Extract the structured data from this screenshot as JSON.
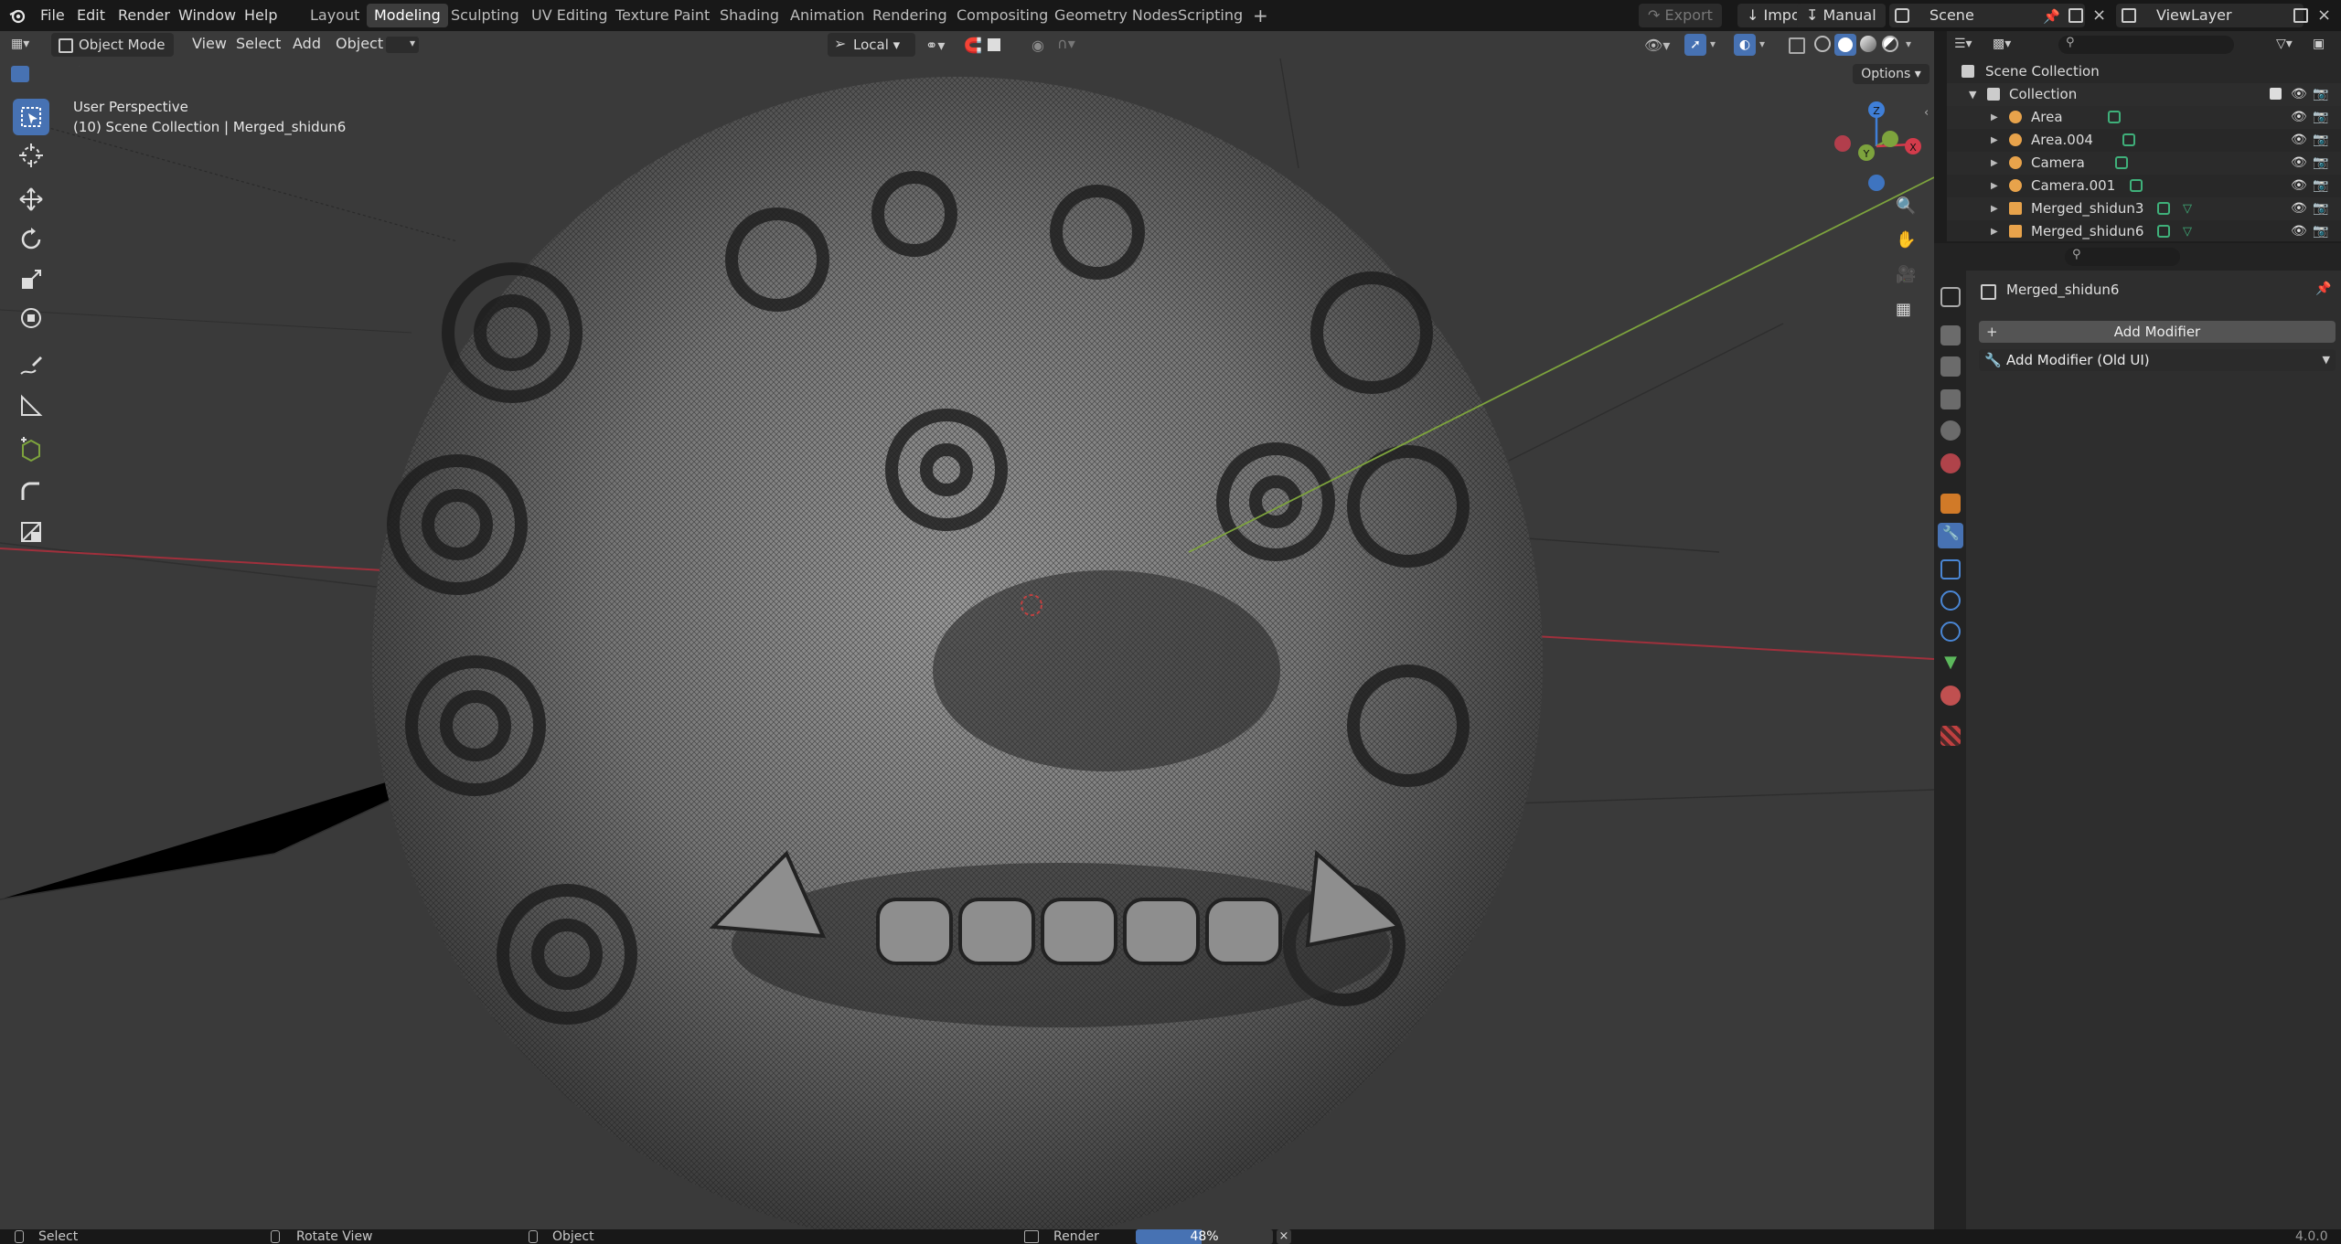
{
  "menubar": {
    "menus": [
      "File",
      "Edit",
      "Render",
      "Window",
      "Help"
    ],
    "workspaces": [
      "Layout",
      "Modeling",
      "Sculpting",
      "UV Editing",
      "Texture Paint",
      "Shading",
      "Animation",
      "Rendering",
      "Compositing",
      "Geometry Nodes",
      "Scripting"
    ],
    "active_workspace": "Modeling",
    "export_label": "Export",
    "import_label": "Import",
    "manual_label": "Manual",
    "scene_name": "Scene",
    "view_layer_name": "ViewLayer"
  },
  "viewport_header": {
    "mode": "Object Mode",
    "menus": [
      "View",
      "Select",
      "Add",
      "Object"
    ],
    "orientation": "Local",
    "options_label": "Options"
  },
  "viewport": {
    "perspective_label": "User Perspective",
    "object_info": "(10) Scene Collection | Merged_shidun6",
    "gizmo_axes": [
      "Z",
      "Y",
      "X"
    ]
  },
  "outliner": {
    "root": "Scene Collection",
    "collection": "Collection",
    "items": [
      {
        "name": "Area",
        "type": "light"
      },
      {
        "name": "Area.004",
        "type": "light"
      },
      {
        "name": "Camera",
        "type": "camera"
      },
      {
        "name": "Camera.001",
        "type": "camera"
      },
      {
        "name": "Merged_shidun3",
        "type": "mesh"
      },
      {
        "name": "Merged_shidun6",
        "type": "mesh"
      }
    ]
  },
  "properties": {
    "object_name": "Merged_shidun6",
    "add_modifier_label": "Add Modifier",
    "add_modifier_old_label": "Add Modifier (Old UI)"
  },
  "statusbar": {
    "select_label": "Select",
    "rotate_label": "Rotate View",
    "object_label": "Object",
    "render_label": "Render",
    "progress_text": "48%",
    "progress_value": 0.48,
    "version": "4.0.0"
  },
  "colors": {
    "accent": "#4772b3",
    "x_axis": "#d33b4b",
    "y_axis": "#7da33d",
    "z_axis": "#3f7fd8"
  }
}
